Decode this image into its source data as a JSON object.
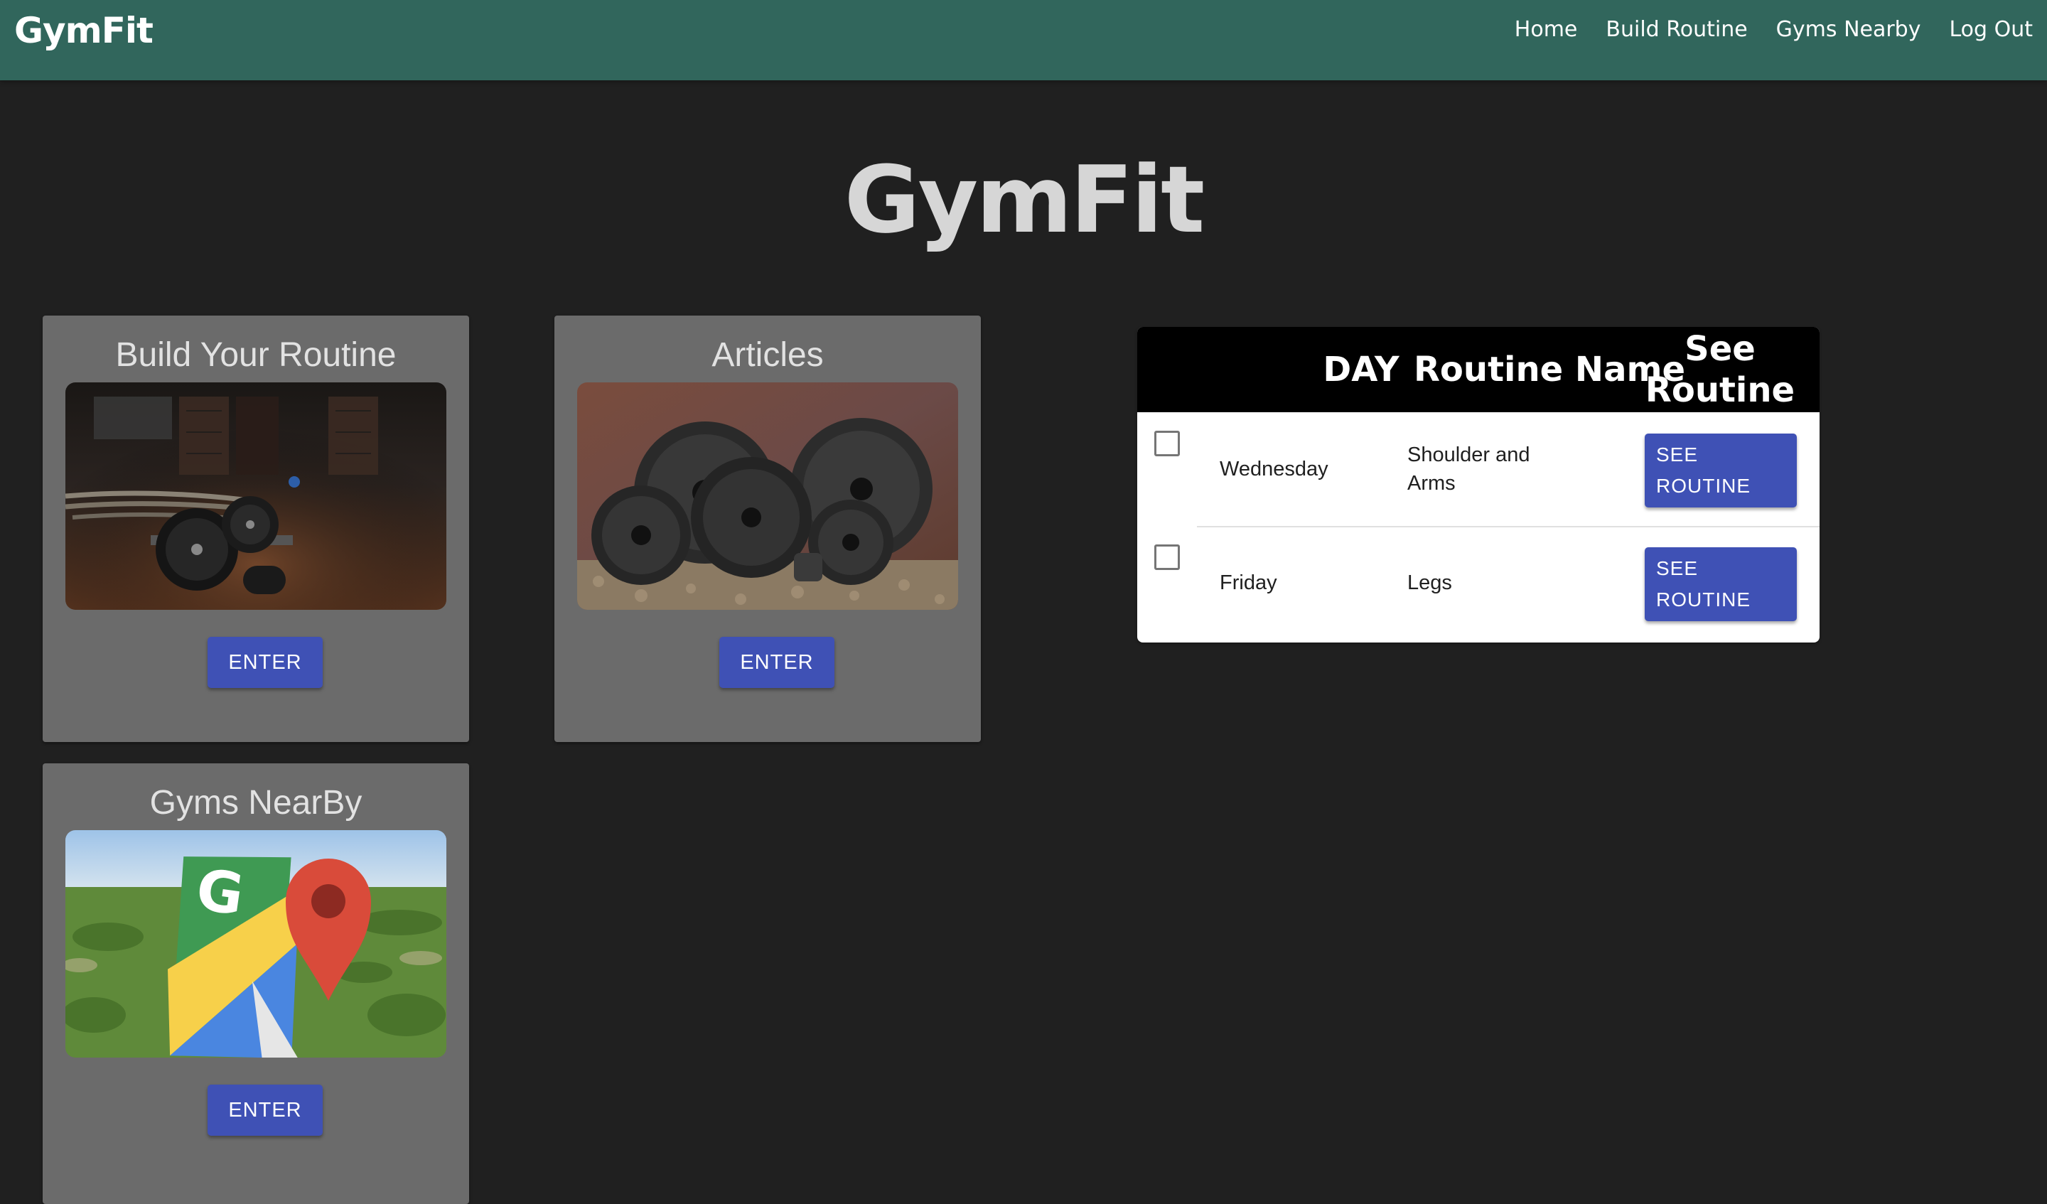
{
  "navbar": {
    "brand": "GymFit",
    "links": [
      "Home",
      "Build Routine",
      "Gyms Nearby",
      "Log Out"
    ]
  },
  "hero": {
    "title": "GymFit"
  },
  "cards": [
    {
      "title": "Build Your Routine",
      "button": "ENTER",
      "image": "gym-barbell-photo"
    },
    {
      "title": "Articles",
      "button": "ENTER",
      "image": "weight-plates-photo"
    },
    {
      "title": "Gyms NearBy",
      "button": "ENTER",
      "image": "google-maps-logo-photo"
    }
  ],
  "routine_table": {
    "headers": {
      "day": "DAY",
      "routine_name": "Routine Name",
      "see_routine": "See Routine"
    },
    "rows": [
      {
        "day": "Wednesday",
        "routine_name": "Shoulder and Arms",
        "button": "SEE ROUTINE",
        "checked": false
      },
      {
        "day": "Friday",
        "routine_name": "Legs",
        "button": "SEE ROUTINE",
        "checked": false
      }
    ]
  },
  "colors": {
    "navbar": "#31665c",
    "background": "#202020",
    "card": "#6b6b6b",
    "button": "#3f51b5"
  }
}
